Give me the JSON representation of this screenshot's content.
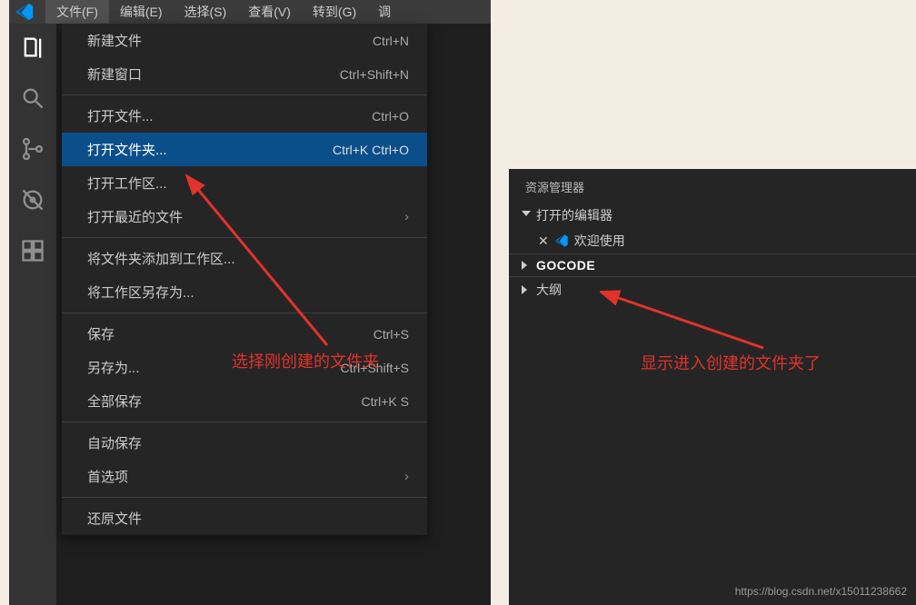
{
  "menubar": {
    "items": [
      "文件(F)",
      "编辑(E)",
      "选择(S)",
      "查看(V)",
      "转到(G)",
      "调"
    ]
  },
  "dropdown": {
    "groups": [
      [
        {
          "label": "新建文件",
          "shortcut": "Ctrl+N"
        },
        {
          "label": "新建窗口",
          "shortcut": "Ctrl+Shift+N"
        }
      ],
      [
        {
          "label": "打开文件...",
          "shortcut": "Ctrl+O"
        },
        {
          "label": "打开文件夹...",
          "shortcut": "Ctrl+K Ctrl+O",
          "highlighted": true
        },
        {
          "label": "打开工作区..."
        },
        {
          "label": "打开最近的文件",
          "submenu": true
        }
      ],
      [
        {
          "label": "将文件夹添加到工作区..."
        },
        {
          "label": "将工作区另存为..."
        }
      ],
      [
        {
          "label": "保存",
          "shortcut": "Ctrl+S"
        },
        {
          "label": "另存为...",
          "shortcut": "Ctrl+Shift+S"
        },
        {
          "label": "全部保存",
          "shortcut": "Ctrl+K S"
        }
      ],
      [
        {
          "label": "自动保存"
        },
        {
          "label": "首选项",
          "submenu": true
        }
      ],
      [
        {
          "label": "还原文件"
        }
      ]
    ]
  },
  "explorer": {
    "title": "资源管理器",
    "openEditors": "打开的编辑器",
    "welcomeTab": "欢迎使用",
    "folder": "GOCODE",
    "outline": "大纲"
  },
  "annotations": {
    "left": "选择刚创建的文件夹",
    "right": "显示进入创建的文件夹了"
  },
  "watermark": "https://blog.csdn.net/x15011238662"
}
